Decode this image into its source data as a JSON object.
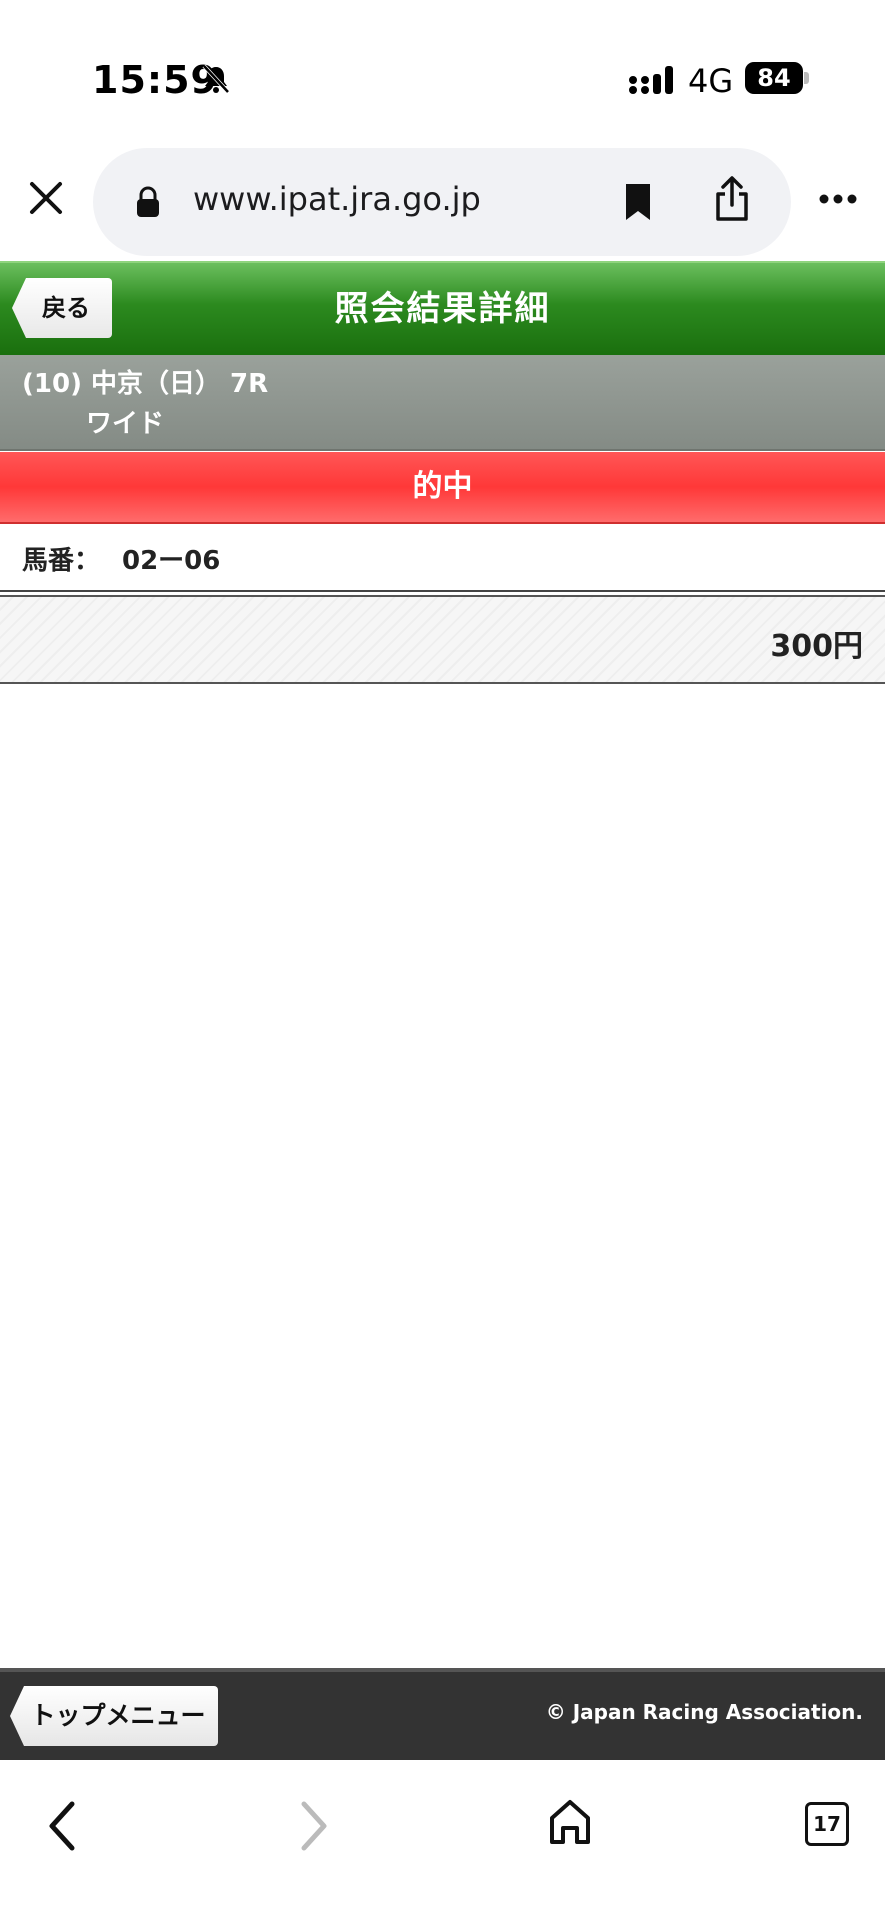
{
  "status_bar": {
    "time": "15:59",
    "network": "4G",
    "battery": "84"
  },
  "browser": {
    "url": "www.ipat.jra.go.jp"
  },
  "header": {
    "back_label": "戻る",
    "title": "照会結果詳細"
  },
  "race": {
    "line1": "(10) 中京（日） 7R",
    "bet_type": "ワイド"
  },
  "result": {
    "status": "的中",
    "horse_label": "馬番：",
    "horse_numbers": "02ー06",
    "amount": "300円"
  },
  "footer": {
    "top_menu_label": "トップメニュー",
    "copyright": "© Japan Racing Association."
  },
  "bottom_nav": {
    "tab_count": "17"
  },
  "colors": {
    "header_green": "#2c8a1f",
    "hit_red": "#ff3838",
    "race_gray": "#8e958f",
    "footer_dark": "#333333"
  }
}
